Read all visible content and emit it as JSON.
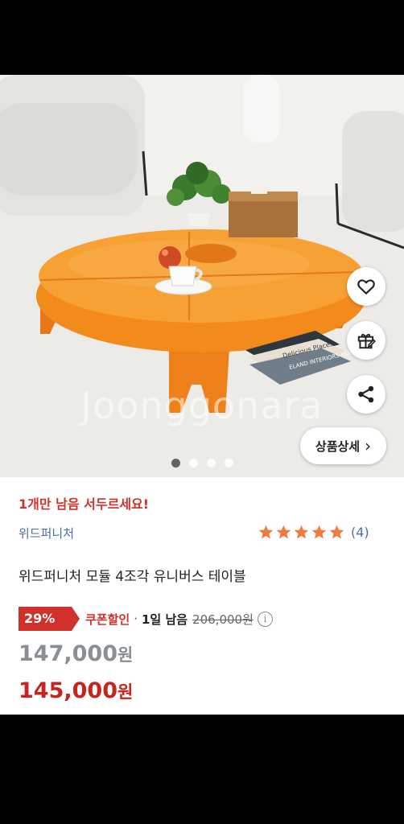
{
  "product_image": {
    "watermark": "Joonggonara",
    "book_titles": [
      "Delicious Places",
      "ELAND INTERIORS HOMES"
    ]
  },
  "actions": {
    "favorite_icon": "heart-icon",
    "gift_icon": "gift-icon",
    "share_icon": "share-icon",
    "detail_label": "상품상세",
    "detail_chevron": "›"
  },
  "carousel": {
    "count": 4,
    "active_index": 0
  },
  "info": {
    "stock_alert": "1개만 남음 서두르세요!",
    "seller": "위드퍼니처",
    "rating_stars": 5,
    "rating_count": "(4)",
    "product_name": "위드퍼니처 모듈 4조각 유니버스 테이블",
    "discount_percent": "29%",
    "coupon_label": "쿠폰할인",
    "separator": "·",
    "remaining": "1일 남음",
    "original_price": "206,000원",
    "info_glyph": "i",
    "sale_price": "147,000",
    "sale_unit": "원",
    "coupon_price": "145,000",
    "coupon_unit": "원"
  },
  "colors": {
    "accent_red": "#d0312d",
    "seller_blue": "#4a6fa5",
    "star_orange": "#f07b3f",
    "table_orange": "#f08a1a"
  }
}
